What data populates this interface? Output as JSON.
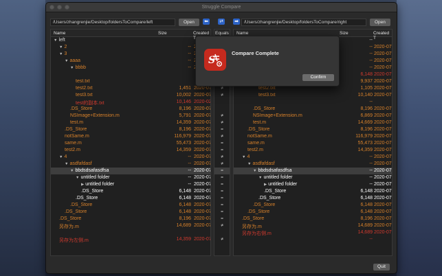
{
  "window": {
    "title": "Struggle Compare"
  },
  "left": {
    "path": "/Users/zhangrenjie/Desktop/foldersToCompare/left",
    "open_label": "Open"
  },
  "right": {
    "path": "/Users/zhangrenjie/Desktop/foldersToCompare/right",
    "open_label": "Open"
  },
  "left_arrow_icon": "left-arrow-icon",
  "right_arrow_icon": "right-arrow-icon",
  "columns": {
    "name": "Name",
    "size": "Size",
    "created": "Created T",
    "equals": "Equals"
  },
  "left_rows": [
    {
      "indent": 0,
      "tri": "▼",
      "name": "left",
      "size": "",
      "date": "",
      "color": "normal"
    },
    {
      "indent": 1,
      "tri": "▼",
      "name": "2",
      "size": "--",
      "date": "2020-07",
      "color": "orange"
    },
    {
      "indent": 1,
      "tri": "▼",
      "name": "3",
      "size": "--",
      "date": "2020-07",
      "color": "orange"
    },
    {
      "indent": 2,
      "tri": "▼",
      "name": "aaaa",
      "size": "--",
      "date": "2020-07",
      "color": "orange"
    },
    {
      "indent": 3,
      "tri": "▼",
      "name": "bbbb",
      "size": "--",
      "date": "2020-07",
      "color": "orange"
    },
    {
      "indent": 4,
      "tri": "",
      "name": "",
      "size": "",
      "date": "",
      "color": "normal"
    },
    {
      "indent": 4,
      "tri": "",
      "name": "test.txt",
      "size": "",
      "date": "",
      "color": "orange"
    },
    {
      "indent": 4,
      "tri": "",
      "name": "test2.txt",
      "size": "1,451",
      "date": "2020-07",
      "color": "orange"
    },
    {
      "indent": 4,
      "tri": "",
      "name": "test3.txt",
      "size": "10,002",
      "date": "2020-07",
      "color": "orange"
    },
    {
      "indent": 4,
      "tri": "",
      "name": "test的副本.txt",
      "size": "10,146",
      "date": "2020-02",
      "color": "red"
    },
    {
      "indent": 3,
      "tri": "",
      "name": ".DS_Store",
      "size": "8,196",
      "date": "2020-07",
      "color": "orange"
    },
    {
      "indent": 3,
      "tri": "",
      "name": "NSImage+Extension.m",
      "size": "5,791",
      "date": "2020-07",
      "color": "orange"
    },
    {
      "indent": 3,
      "tri": "",
      "name": "test.m",
      "size": "14,359",
      "date": "2020-07",
      "color": "orange"
    },
    {
      "indent": 2,
      "tri": "",
      "name": ".DS_Store",
      "size": "8,196",
      "date": "2020-07",
      "color": "orange"
    },
    {
      "indent": 2,
      "tri": "",
      "name": "notSame.m",
      "size": "116,979",
      "date": "2020-07",
      "color": "orange"
    },
    {
      "indent": 2,
      "tri": "",
      "name": "same.m",
      "size": "55,473",
      "date": "2020-07",
      "color": "orange"
    },
    {
      "indent": 2,
      "tri": "",
      "name": "test2.m",
      "size": "14,359",
      "date": "2020-07",
      "color": "orange"
    },
    {
      "indent": 1,
      "tri": "▼",
      "name": "4",
      "size": "--",
      "date": "2020-07",
      "color": "orange"
    },
    {
      "indent": 2,
      "tri": "▼",
      "name": "asdfafdasf",
      "size": "--",
      "date": "2020-07",
      "color": "orange"
    },
    {
      "indent": 3,
      "tri": "▼",
      "name": "bbdsdsafasdfsa",
      "size": "--",
      "date": "2020-07",
      "color": "white",
      "sel": true
    },
    {
      "indent": 4,
      "tri": "▼",
      "name": "untitled folder",
      "size": "--",
      "date": "2020-07",
      "color": "white"
    },
    {
      "indent": 5,
      "tri": "▶",
      "name": "untitled folder",
      "size": "--",
      "date": "2020-07",
      "color": "white"
    },
    {
      "indent": 5,
      "tri": "",
      "name": ".DS_Store",
      "size": "6,148",
      "date": "2020-07",
      "color": "white"
    },
    {
      "indent": 4,
      "tri": "",
      "name": ".DS_Store",
      "size": "6,148",
      "date": "2020-07",
      "color": "white"
    },
    {
      "indent": 3,
      "tri": "",
      "name": ".DS_Store",
      "size": "6,148",
      "date": "2020-07",
      "color": "orange"
    },
    {
      "indent": 2,
      "tri": "",
      "name": ".DS_Store",
      "size": "6,148",
      "date": "2020-07",
      "color": "orange"
    },
    {
      "indent": 1,
      "tri": "",
      "name": ".DS_Store",
      "size": "8,196",
      "date": "2020-07",
      "color": "orange"
    },
    {
      "indent": 1,
      "tri": "",
      "name": "另存为.m",
      "size": "14,689",
      "date": "2020-07",
      "color": "orange"
    },
    {
      "indent": 1,
      "tri": "",
      "name": "",
      "size": "",
      "date": "",
      "color": "normal"
    },
    {
      "indent": 1,
      "tri": "",
      "name": "另存为左侧.m",
      "size": "14,359",
      "date": "2020-07",
      "color": "red"
    }
  ],
  "right_rows": [
    {
      "indent": 0,
      "tri": "",
      "name": "",
      "size": "--",
      "date": "",
      "color": "normal"
    },
    {
      "indent": 1,
      "tri": "",
      "name": "",
      "size": "--",
      "date": "2020-07",
      "color": "orange"
    },
    {
      "indent": 1,
      "tri": "",
      "name": "",
      "size": "--",
      "date": "2020-07",
      "color": "orange"
    },
    {
      "indent": 2,
      "tri": "",
      "name": "",
      "size": "--",
      "date": "2020-07",
      "color": "orange"
    },
    {
      "indent": 3,
      "tri": "",
      "name": "",
      "size": "--",
      "date": "2020-07",
      "color": "orange"
    },
    {
      "indent": 4,
      "tri": "",
      "name": "",
      "size": "6,148",
      "date": "2020-07",
      "color": "red"
    },
    {
      "indent": 4,
      "tri": "",
      "name": "",
      "size": "9,937",
      "date": "2020-07",
      "color": "orange"
    },
    {
      "indent": 4,
      "tri": "",
      "name": "test2.txt",
      "size": "1,105",
      "date": "2020-07",
      "color": "orange"
    },
    {
      "indent": 4,
      "tri": "",
      "name": "test3.txt",
      "size": "10,140",
      "date": "2020-07",
      "color": "orange"
    },
    {
      "indent": 4,
      "tri": "",
      "name": "",
      "size": "--",
      "date": "",
      "color": "orange"
    },
    {
      "indent": 3,
      "tri": "",
      "name": ".DS_Store",
      "size": "8,196",
      "date": "2020-07",
      "color": "orange"
    },
    {
      "indent": 3,
      "tri": "",
      "name": "NSImage+Extension.m",
      "size": "6,869",
      "date": "2020-07",
      "color": "orange"
    },
    {
      "indent": 3,
      "tri": "",
      "name": "test.m",
      "size": "14,669",
      "date": "2020-07",
      "color": "orange"
    },
    {
      "indent": 2,
      "tri": "",
      "name": ".DS_Store",
      "size": "8,196",
      "date": "2020-07",
      "color": "orange"
    },
    {
      "indent": 2,
      "tri": "",
      "name": "notSame.m",
      "size": "116,979",
      "date": "2020-07",
      "color": "orange"
    },
    {
      "indent": 2,
      "tri": "",
      "name": "same.m",
      "size": "55,473",
      "date": "2020-07",
      "color": "orange"
    },
    {
      "indent": 2,
      "tri": "",
      "name": "test2.m",
      "size": "14,359",
      "date": "2020-07",
      "color": "orange"
    },
    {
      "indent": 1,
      "tri": "▼",
      "name": "4",
      "size": "--",
      "date": "2020-07",
      "color": "orange"
    },
    {
      "indent": 2,
      "tri": "▼",
      "name": "asdfafdasf",
      "size": "--",
      "date": "2020-07",
      "color": "orange"
    },
    {
      "indent": 3,
      "tri": "▼",
      "name": "bbdsdsafasdfsa",
      "size": "--",
      "date": "2020-07",
      "color": "white",
      "sel": true
    },
    {
      "indent": 4,
      "tri": "▼",
      "name": "untitled folder",
      "size": "--",
      "date": "2020-07",
      "color": "white"
    },
    {
      "indent": 5,
      "tri": "▶",
      "name": "untitled folder",
      "size": "--",
      "date": "2020-07",
      "color": "white"
    },
    {
      "indent": 5,
      "tri": "",
      "name": ".DS_Store",
      "size": "6,148",
      "date": "2020-07",
      "color": "white"
    },
    {
      "indent": 4,
      "tri": "",
      "name": ".DS_Store",
      "size": "6,148",
      "date": "2020-07",
      "color": "white"
    },
    {
      "indent": 3,
      "tri": "",
      "name": ".DS_Store",
      "size": "6,148",
      "date": "2020-07",
      "color": "orange"
    },
    {
      "indent": 2,
      "tri": "",
      "name": ".DS_Store",
      "size": "6,148",
      "date": "2020-07",
      "color": "orange"
    },
    {
      "indent": 1,
      "tri": "",
      "name": ".DS_Store",
      "size": "8,196",
      "date": "2020-07",
      "color": "orange"
    },
    {
      "indent": 1,
      "tri": "",
      "name": "另存为.m",
      "size": "14,689",
      "date": "2020-07",
      "color": "orange"
    },
    {
      "indent": 1,
      "tri": "",
      "name": "另存为右侧.m",
      "size": "14,689",
      "date": "2020-07",
      "color": "red"
    },
    {
      "indent": 1,
      "tri": "",
      "name": "",
      "size": "--",
      "date": "",
      "color": "red"
    }
  ],
  "equals": [
    "",
    "≠",
    "≠",
    "≠",
    "≠",
    "",
    "",
    "≠",
    "≠",
    "",
    "",
    "≠",
    "≠",
    "=",
    "≠",
    "=",
    "=",
    "≠",
    "≠",
    "=",
    "=",
    "=",
    "=",
    "=",
    "=",
    "=",
    "=",
    "≠",
    "",
    "≠"
  ],
  "dialog": {
    "title": "Compare Complete",
    "confirm_label": "Confirm",
    "icon": "app-logo-icon"
  },
  "quit_label": "Quit",
  "colors": {
    "orange": "#d9822b",
    "red": "#d23a2e",
    "white": "#ffffff",
    "normal": "#d4d4d4",
    "accent": "#2d63c6"
  }
}
